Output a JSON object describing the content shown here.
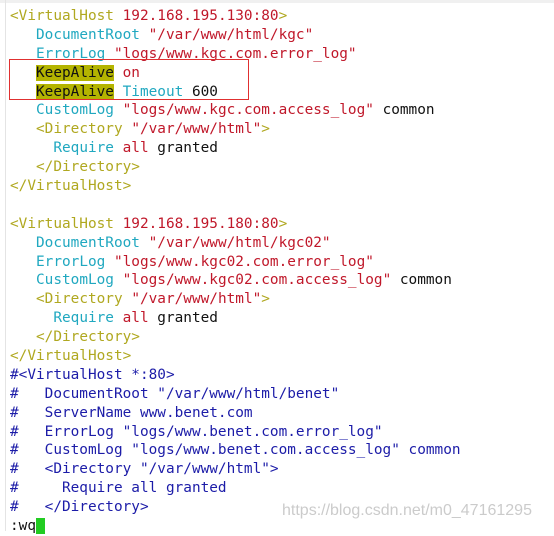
{
  "colors": {
    "tag": "#b0a820",
    "string": "#c0182a",
    "keyword": "#20a8c0",
    "comment": "#1c1ca8",
    "highlight": "#b4b400",
    "box": "#e03030",
    "cursor": "#22cc22"
  },
  "lines": [
    [
      [
        "<VirtualHost ",
        "tag"
      ],
      [
        "192.168.195.130:80",
        "str"
      ],
      [
        ">",
        "tag"
      ]
    ],
    [
      [
        "   ",
        "txt"
      ],
      [
        "DocumentRoot",
        "kw"
      ],
      [
        " \"/var/www/html/kgc\"",
        "str"
      ]
    ],
    [
      [
        "   ",
        "txt"
      ],
      [
        "ErrorLog",
        "kw"
      ],
      [
        " \"logs/www.kgc.com.error_log\"",
        "str"
      ]
    ],
    [
      [
        "   ",
        "txt"
      ],
      [
        "KeepAlive",
        "hl"
      ],
      [
        " on",
        "str"
      ]
    ],
    [
      [
        "   ",
        "txt"
      ],
      [
        "KeepAlive",
        "hl"
      ],
      [
        " Timeout",
        "kw"
      ],
      [
        " 600",
        "txt"
      ]
    ],
    [
      [
        "   ",
        "txt"
      ],
      [
        "CustomLog",
        "kw"
      ],
      [
        " \"logs/www.kgc.com.access_log\"",
        "str"
      ],
      [
        " common",
        "txt"
      ]
    ],
    [
      [
        "   ",
        "txt"
      ],
      [
        "<Directory ",
        "tag"
      ],
      [
        "\"/var/www/html\"",
        "str"
      ],
      [
        ">",
        "tag"
      ]
    ],
    [
      [
        "     ",
        "txt"
      ],
      [
        "Require",
        "kw"
      ],
      [
        " all",
        "str"
      ],
      [
        " granted",
        "txt"
      ]
    ],
    [
      [
        "   ",
        "txt"
      ],
      [
        "</Directory>",
        "tag"
      ]
    ],
    [
      [
        "</VirtualHost>",
        "tag"
      ]
    ],
    [],
    [
      [
        "<VirtualHost ",
        "tag"
      ],
      [
        "192.168.195.180:80",
        "str"
      ],
      [
        ">",
        "tag"
      ]
    ],
    [
      [
        "   ",
        "txt"
      ],
      [
        "DocumentRoot",
        "kw"
      ],
      [
        " \"/var/www/html/kgc02\"",
        "str"
      ]
    ],
    [
      [
        "   ",
        "txt"
      ],
      [
        "ErrorLog",
        "kw"
      ],
      [
        " \"logs/www.kgc02.com.error_log\"",
        "str"
      ]
    ],
    [
      [
        "   ",
        "txt"
      ],
      [
        "CustomLog",
        "kw"
      ],
      [
        " \"logs/www.kgc02.com.access_log\"",
        "str"
      ],
      [
        " common",
        "txt"
      ]
    ],
    [
      [
        "   ",
        "txt"
      ],
      [
        "<Directory ",
        "tag"
      ],
      [
        "\"/var/www/html\"",
        "str"
      ],
      [
        ">",
        "tag"
      ]
    ],
    [
      [
        "     ",
        "txt"
      ],
      [
        "Require",
        "kw"
      ],
      [
        " all",
        "str"
      ],
      [
        " granted",
        "txt"
      ]
    ],
    [
      [
        "   ",
        "txt"
      ],
      [
        "</Directory>",
        "tag"
      ]
    ],
    [
      [
        "</VirtualHost>",
        "tag"
      ]
    ],
    [
      [
        "#<VirtualHost *:80>",
        "cmt"
      ]
    ],
    [
      [
        "#   DocumentRoot \"/var/www/html/benet\"",
        "cmt"
      ]
    ],
    [
      [
        "#   ServerName www.benet.com",
        "cmt"
      ]
    ],
    [
      [
        "#   ErrorLog \"logs/www.benet.com.error_log\"",
        "cmt"
      ]
    ],
    [
      [
        "#   CustomLog \"logs/www.benet.com.access_log\" common",
        "cmt"
      ]
    ],
    [
      [
        "#   <Directory \"/var/www/html\">",
        "cmt"
      ]
    ],
    [
      [
        "#     Require all granted",
        "cmt"
      ]
    ],
    [
      [
        "#   </Directory>",
        "cmt"
      ]
    ]
  ],
  "command_line": ":wq",
  "watermark": "https://blog.csdn.net/m0_47161295"
}
